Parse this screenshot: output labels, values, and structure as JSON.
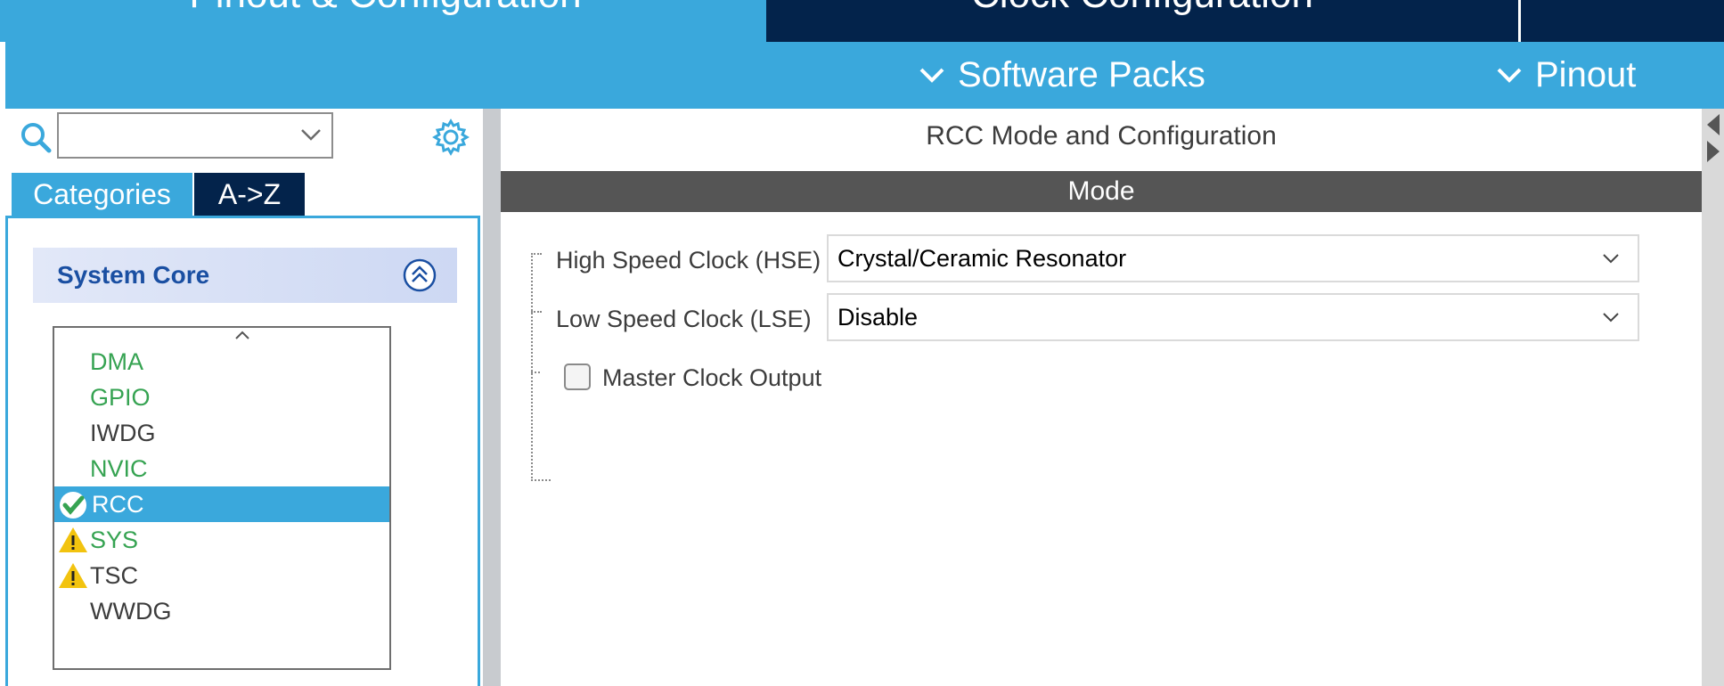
{
  "top_tabs": {
    "pinout": "Pinout & Configuration",
    "clock": "Clock Configuration"
  },
  "toolbar": {
    "software_packs": "Software Packs",
    "pinout": "Pinout"
  },
  "left_panel": {
    "search": {
      "value": "",
      "placeholder": ""
    },
    "tabs": {
      "categories": "Categories",
      "az": "A->Z"
    },
    "category_header": "System Core",
    "items": [
      {
        "label": "DMA",
        "status": "ok-configured"
      },
      {
        "label": "GPIO",
        "status": "ok-configured"
      },
      {
        "label": "IWDG",
        "status": "none"
      },
      {
        "label": "NVIC",
        "status": "ok-configured"
      },
      {
        "label": "RCC",
        "status": "selected-checked"
      },
      {
        "label": "SYS",
        "status": "warning"
      },
      {
        "label": "TSC",
        "status": "warning"
      },
      {
        "label": "WWDG",
        "status": "none"
      }
    ]
  },
  "right_panel": {
    "title": "RCC Mode and Configuration",
    "mode_header": "Mode",
    "hse": {
      "label": "High Speed Clock (HSE)",
      "value": "Crystal/Ceramic Resonator"
    },
    "lse": {
      "label": "Low Speed Clock (LSE)",
      "value": "Disable"
    },
    "mco": {
      "label": "Master Clock Output",
      "checked": false
    }
  },
  "colors": {
    "accent_blue": "#3aa8dc",
    "navy": "#03234b",
    "mode_bar": "#555555",
    "ok_green": "#36a352",
    "warning_yellow": "#f2c30f"
  }
}
